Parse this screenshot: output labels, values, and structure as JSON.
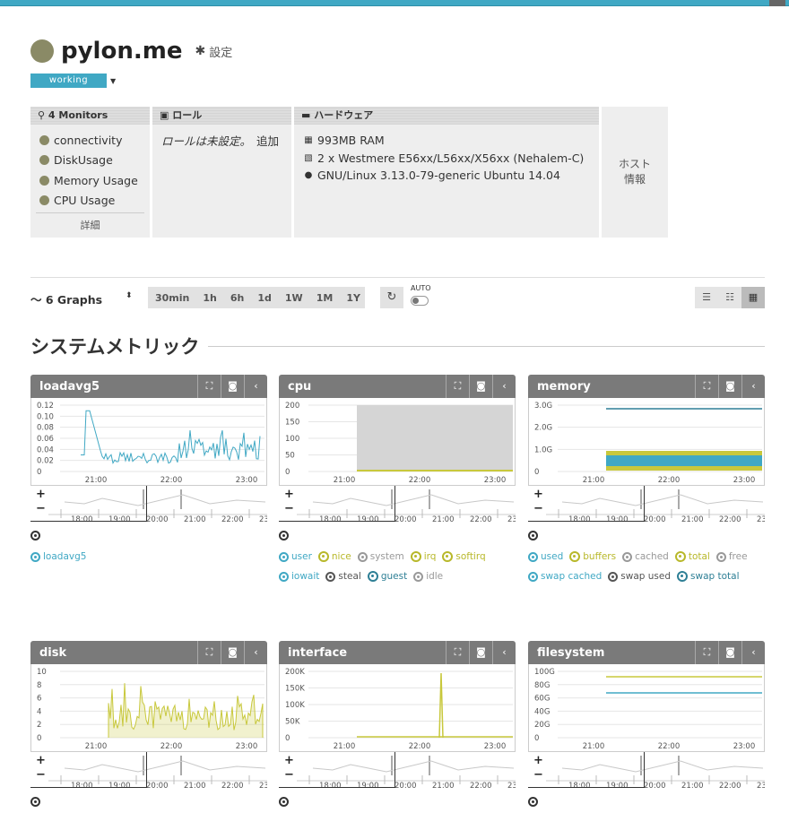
{
  "host": {
    "name": "pylon.me",
    "settings_label": "設定",
    "status": "working"
  },
  "monitors": {
    "header": "4 Monitors",
    "items": [
      "connectivity",
      "DiskUsage",
      "Memory Usage",
      "CPU Usage"
    ],
    "detail_label": "詳細"
  },
  "roles": {
    "header": "ロール",
    "empty_text": "ロールは未設定。",
    "add_label": "追加"
  },
  "hardware": {
    "header": "ハードウェア",
    "lines": [
      "993MB RAM",
      "2 x Westmere E56xx/L56xx/X56xx (Nehalem-C)",
      "GNU/Linux 3.13.0-79-generic Ubuntu 14.04"
    ]
  },
  "host_info_label": "ホスト\n情報",
  "toolbar": {
    "graphs_label": "6 Graphs",
    "ranges": [
      "30min",
      "1h",
      "6h",
      "1d",
      "1W",
      "1M",
      "1Y"
    ],
    "auto_label": "AUTO"
  },
  "section_title": "システムメトリック",
  "colors": {
    "blue": "#40a8c4",
    "yellow": "#c8c83c",
    "gray": "#999999",
    "header": "#7a7a7a"
  },
  "graphs": [
    {
      "title": "loadavg5",
      "y_ticks": [
        "0.12",
        "0.10",
        "0.08",
        "0.06",
        "0.04",
        "0.02",
        "0"
      ],
      "x_ticks": [
        "21:00",
        "22:00",
        "23:00"
      ],
      "nav_ticks": [
        "18:00",
        "19:00",
        "20:00",
        "21:00",
        "22:00",
        "23"
      ],
      "legend": [
        {
          "label": "loadavg5",
          "color": "#40a8c4",
          "bold": false
        }
      ]
    },
    {
      "title": "cpu",
      "y_ticks": [
        "200",
        "150",
        "100",
        "50",
        "0"
      ],
      "x_ticks": [
        "21:00",
        "22:00",
        "23:00"
      ],
      "nav_ticks": [
        "18:00",
        "19:00",
        "20:00",
        "21:00",
        "22:00",
        "23"
      ],
      "legend": [
        {
          "label": "user",
          "color": "#40a8c4",
          "bold": false
        },
        {
          "label": "nice",
          "color": "#b8b82a",
          "bold": true
        },
        {
          "label": "system",
          "color": "#999999",
          "bold": false
        },
        {
          "label": "irq",
          "color": "#b8b82a",
          "bold": true
        },
        {
          "label": "softirq",
          "color": "#b8b82a",
          "bold": true
        },
        {
          "label": "iowait",
          "color": "#40a8c4",
          "bold": false
        },
        {
          "label": "steal",
          "color": "#555555",
          "bold": false
        },
        {
          "label": "guest",
          "color": "#2e7f95",
          "bold": true
        },
        {
          "label": "idle",
          "color": "#999999",
          "bold": false
        }
      ]
    },
    {
      "title": "memory",
      "y_ticks": [
        "3.0G",
        "2.0G",
        "1.0G",
        "0"
      ],
      "x_ticks": [
        "21:00",
        "22:00",
        "23:00"
      ],
      "nav_ticks": [
        "18:00",
        "19:00",
        "20:00",
        "21:00",
        "22:00",
        "23"
      ],
      "legend": [
        {
          "label": "used",
          "color": "#40a8c4",
          "bold": false
        },
        {
          "label": "buffers",
          "color": "#b8b82a",
          "bold": true
        },
        {
          "label": "cached",
          "color": "#999999",
          "bold": false
        },
        {
          "label": "total",
          "color": "#b8b82a",
          "bold": true
        },
        {
          "label": "free",
          "color": "#999999",
          "bold": false
        },
        {
          "label": "swap cached",
          "color": "#40a8c4",
          "bold": false
        },
        {
          "label": "swap used",
          "color": "#555555",
          "bold": false
        },
        {
          "label": "swap total",
          "color": "#2e7f95",
          "bold": true
        }
      ]
    },
    {
      "title": "disk",
      "y_ticks": [
        "10",
        "8",
        "6",
        "4",
        "2",
        "0"
      ],
      "x_ticks": [
        "21:00",
        "22:00",
        "23:00"
      ],
      "nav_ticks": [
        "18:00",
        "19:00",
        "20:00",
        "21:00",
        "22:00",
        "23"
      ],
      "legend": []
    },
    {
      "title": "interface",
      "y_ticks": [
        "200K",
        "150K",
        "100K",
        "50K",
        "0"
      ],
      "x_ticks": [
        "21:00",
        "22:00",
        "23:00"
      ],
      "nav_ticks": [
        "18:00",
        "19:00",
        "20:00",
        "21:00",
        "22:00",
        "23"
      ],
      "legend": []
    },
    {
      "title": "filesystem",
      "y_ticks": [
        "100G",
        "80G",
        "60G",
        "40G",
        "20G",
        "0"
      ],
      "x_ticks": [
        "21:00",
        "22:00",
        "23:00"
      ],
      "nav_ticks": [
        "18:00",
        "19:00",
        "20:00",
        "21:00",
        "22:00",
        "23"
      ],
      "legend": []
    }
  ]
}
